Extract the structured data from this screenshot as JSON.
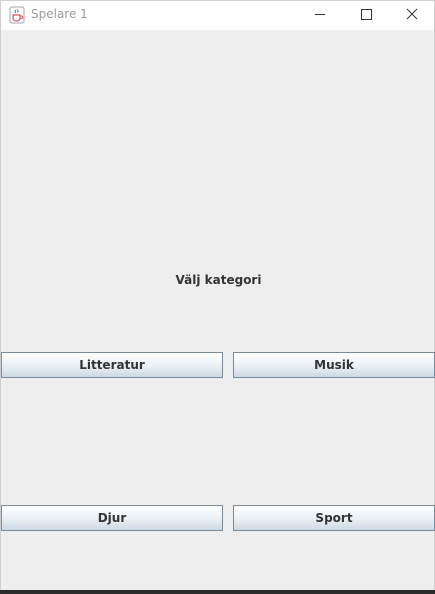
{
  "window": {
    "title": "Spelare 1",
    "app_icon": "java-cup-icon",
    "controls": [
      "minimize-icon",
      "maximize-icon",
      "close-icon"
    ]
  },
  "main": {
    "heading": "Välj kategori",
    "categories": [
      {
        "label": "Litteratur"
      },
      {
        "label": "Musik"
      },
      {
        "label": "Djur"
      },
      {
        "label": "Sport"
      }
    ]
  },
  "colors": {
    "background": "#eeeeee",
    "titlebar": "#ffffff",
    "title_text": "#9a9a9a",
    "button_border": "#7a8a99",
    "text": "#333333"
  }
}
